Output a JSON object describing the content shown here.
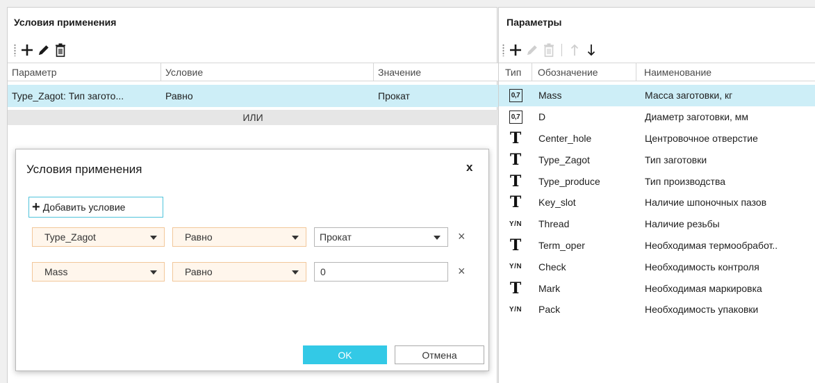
{
  "left_panel": {
    "title": "Условия применения",
    "columns": [
      "Параметр",
      "Условие",
      "Значение"
    ],
    "rows": [
      {
        "param": "Type_Zagot: Тип загото...",
        "condition": "Равно",
        "value": "Прокат"
      }
    ],
    "or_label": "ИЛИ"
  },
  "right_panel": {
    "title": "Параметры",
    "columns": [
      "Тип",
      "Обозначение",
      "Наименование"
    ],
    "rows": [
      {
        "type": "number-icon",
        "type_glyph": "0,7",
        "name": "Mass",
        "description": "Масса заготовки, кг"
      },
      {
        "type": "number-icon",
        "type_glyph": "0,7",
        "name": "D",
        "description": "Диаметр заготовки, мм"
      },
      {
        "type": "text-icon",
        "type_glyph": "T",
        "name": "Center_hole",
        "description": "Центровочное отверстие"
      },
      {
        "type": "text-icon",
        "type_glyph": "T",
        "name": "Type_Zagot",
        "description": "Тип заготовки"
      },
      {
        "type": "text-icon",
        "type_glyph": "T",
        "name": "Type_produce",
        "description": "Тип производства"
      },
      {
        "type": "text-icon",
        "type_glyph": "T",
        "name": "Key_slot",
        "description": "Наличие шпоночных пазов"
      },
      {
        "type": "boolean-icon",
        "type_glyph": "Y/N",
        "name": "Thread",
        "description": "Наличие резьбы"
      },
      {
        "type": "text-icon",
        "type_glyph": "T",
        "name": "Term_oper",
        "description": "Необходимая термообработ.."
      },
      {
        "type": "boolean-icon",
        "type_glyph": "Y/N",
        "name": "Check",
        "description": "Необходимость контроля"
      },
      {
        "type": "text-icon",
        "type_glyph": "T",
        "name": "Mark",
        "description": "Необходимая маркировка"
      },
      {
        "type": "boolean-icon",
        "type_glyph": "Y/N",
        "name": "Pack",
        "description": "Необходимость упаковки"
      }
    ]
  },
  "dialog": {
    "title": "Условия применения",
    "close": "x",
    "add_condition": "Добавить условие",
    "add_plus": "+",
    "conditions": [
      {
        "parameter": "Type_Zagot",
        "operator": "Равно",
        "value": "Прокат",
        "remove": "×"
      },
      {
        "parameter": "Mass",
        "operator": "Равно",
        "value": "0",
        "remove": "×"
      }
    ],
    "ok": "OK",
    "cancel": "Отмена"
  },
  "colors": {
    "selection": "#cdeef7",
    "accent": "#33c9e6",
    "combo_border": "#f2c79a",
    "combo_fill": "#fff6ec"
  }
}
